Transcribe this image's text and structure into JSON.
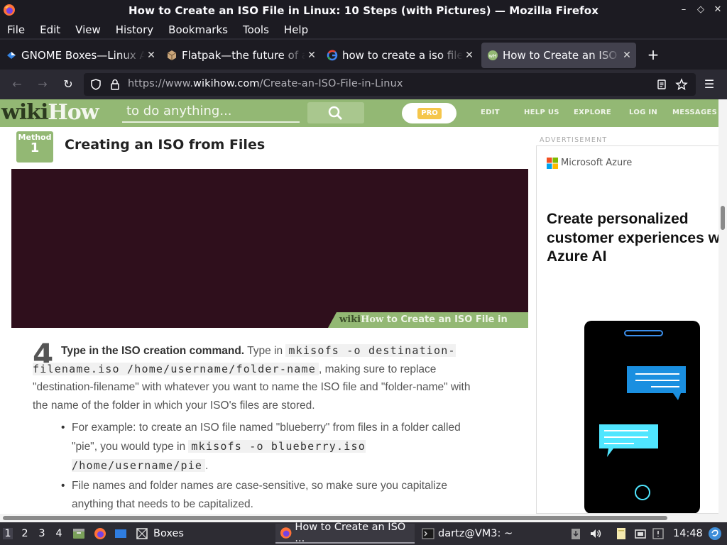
{
  "window": {
    "title": "How to Create an ISO File in Linux: 10 Steps (with Pictures) — Mozilla Firefox",
    "minimize": "–",
    "maximize": "◇",
    "close": "✕"
  },
  "menu": [
    "File",
    "Edit",
    "View",
    "History",
    "Bookmarks",
    "Tools",
    "Help"
  ],
  "tabs": [
    {
      "label": "GNOME Boxes—Linux Apps on Flathub",
      "icon": "gnome-boxes-icon",
      "close": "✕"
    },
    {
      "label": "Flatpak—the future of application distribution",
      "icon": "flatpak-icon",
      "close": "✕"
    },
    {
      "label": "how to create a iso file in linux - Google Search",
      "icon": "google-icon",
      "close": "✕"
    },
    {
      "label": "How to Create an ISO File in Linux",
      "icon": "wikihow-icon",
      "close": "✕"
    }
  ],
  "new_tab": "+",
  "nav": {
    "back": "←",
    "forward": "→",
    "reload": "↻",
    "url_prefix": "https://www.",
    "url_domain": "wikihow.com",
    "url_path": "/Create-an-ISO-File-in-Linux",
    "menu": "☰"
  },
  "wikihow": {
    "logo_a": "wiki",
    "logo_b": "How",
    "search_placeholder": "to do anything...",
    "pro": "PRO",
    "nav": [
      "EDIT",
      "HELP US",
      "EXPLORE",
      "LOG IN",
      "MESSAGES"
    ]
  },
  "article": {
    "method_label": "Method",
    "method_number": "1",
    "method_title": "Creating an ISO from Files",
    "hero_caption_a": "wiki",
    "hero_caption_b": "How",
    "hero_caption_c": " to Create an ISO File in Linux",
    "step_number": "4",
    "step_bold": "Type in the ISO creation command.",
    "step_pre": " Type in ",
    "step_code": "mkisofs -o destination-filename.iso /home/username/folder-name",
    "step_post": ", making sure to replace \"destination-filename\" with whatever you want to name the ISO file and \"folder-name\" with the name of the folder in which your ISO's files are stored.",
    "bullet1_pre": "For example: to create an ISO file named \"blueberry\" from files in a folder called \"pie\", you would type in ",
    "bullet1_code": "mkisofs -o blueberry.iso /home/username/pie",
    "bullet1_post": ".",
    "bullet2": "File names and folder names are case-sensitive, so make sure you capitalize anything that needs to be capitalized."
  },
  "ad": {
    "label": "ADVERTISEMENT",
    "brand": "Microsoft Azure",
    "headline": "Create personalized customer experiences with Azure AI"
  },
  "taskbar": {
    "workspaces": [
      "1",
      "2",
      "3",
      "4"
    ],
    "boxes": "Boxes",
    "firefox_task": "How to Create an ISO ...",
    "terminal_task": "dartz@VM3: ~",
    "clock": "14:48"
  },
  "colors": {
    "wikihow_green": "#93b874",
    "firefox_dark": "#1c1b22",
    "hero": "#2f0f1c"
  }
}
